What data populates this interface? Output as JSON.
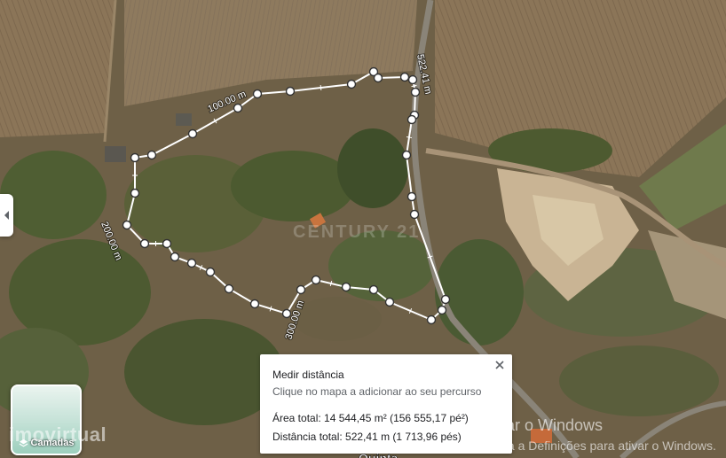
{
  "map": {
    "watermark_center": "CENTURY 21",
    "watermark_bottom": "imovirtual",
    "partial_place_label": "Quinta",
    "measure_labels": {
      "d100": "100.00 m",
      "d200": "200.00 m",
      "d300": "300.00 m",
      "total": "522.41 m"
    },
    "path_color": "#ffffff",
    "waypoint_fill": "#ffffff",
    "waypoint_stroke": "#333333"
  },
  "side_tab": {
    "icon": "chevron-left-icon"
  },
  "layers_button": {
    "label": "Camadas",
    "icon": "layers-icon"
  },
  "measure_panel": {
    "title": "Medir distância",
    "hint": "Clique no mapa a adicionar ao seu percurso",
    "area_line": "Área total: 14 544,45 m² (156 555,17 pé²)",
    "distance_line": "Distância total: 522,41 m (1 713,96 pés)",
    "close_icon": "close-icon"
  },
  "windows_activation": {
    "title": "Ativar o Windows",
    "subtitle": "Aceda a Definições para ativar o Windows."
  }
}
